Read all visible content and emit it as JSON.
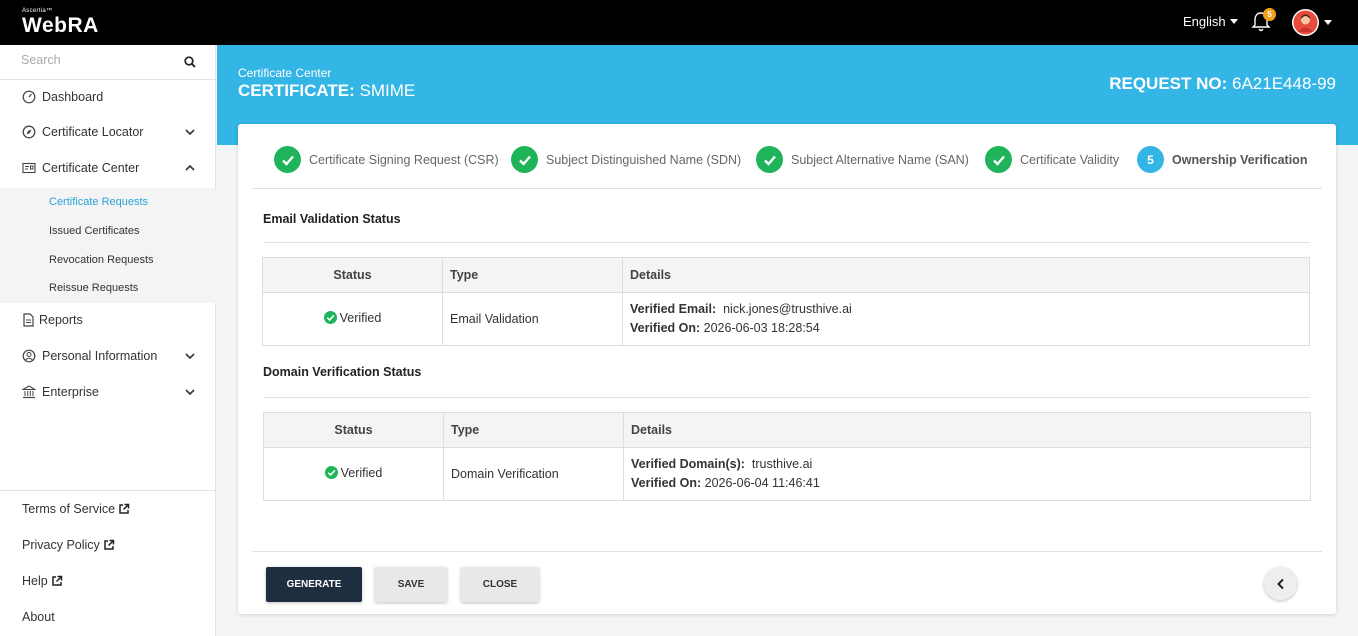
{
  "topbar": {
    "logo_small": "Ascertia™",
    "logo_main": "WebRA",
    "language": "English",
    "notification_count": "5"
  },
  "sidebar": {
    "search_placeholder": "Search",
    "items": [
      {
        "label": "Dashboard"
      },
      {
        "label": "Certificate Locator"
      },
      {
        "label": "Certificate Center"
      },
      {
        "label": "Reports"
      },
      {
        "label": "Personal Information"
      },
      {
        "label": "Enterprise"
      }
    ],
    "sub_items": [
      {
        "label": "Certificate Requests"
      },
      {
        "label": "Issued Certificates"
      },
      {
        "label": "Revocation Requests"
      },
      {
        "label": "Reissue Requests"
      }
    ],
    "footer": [
      {
        "label": "Terms of Service"
      },
      {
        "label": "Privacy Policy"
      },
      {
        "label": "Help"
      },
      {
        "label": "About"
      }
    ]
  },
  "header": {
    "breadcrumb": "Certificate Center",
    "title_prefix": "CERTIFICATE:",
    "title_value": "SMIME",
    "request_prefix": "REQUEST NO:",
    "request_value": "6A21E448-99"
  },
  "steps": [
    {
      "label": "Certificate Signing Request (CSR)",
      "done": true
    },
    {
      "label": "Subject Distinguished Name (SDN)",
      "done": true
    },
    {
      "label": "Subject Alternative Name (SAN)",
      "done": true
    },
    {
      "label": "Certificate Validity",
      "done": true
    },
    {
      "label": "Ownership Verification",
      "done": false,
      "number": "5"
    }
  ],
  "email_section": {
    "title": "Email Validation Status",
    "headers": {
      "status": "Status",
      "type": "Type",
      "details": "Details"
    },
    "row": {
      "status": "Verified",
      "type": "Email Validation",
      "detail1_label": "Verified Email:",
      "detail1_value": "nick.jones@trusthive.ai",
      "detail2_label": "Verified On:",
      "detail2_value": "2026-06-03 18:28:54"
    }
  },
  "domain_section": {
    "title": "Domain Verification Status",
    "headers": {
      "status": "Status",
      "type": "Type",
      "details": "Details"
    },
    "row": {
      "status": "Verified",
      "type": "Domain Verification",
      "detail1_label": "Verified Domain(s):",
      "detail1_value": "trusthive.ai",
      "detail2_label": "Verified On:",
      "detail2_value": "2026-06-04 11:46:41"
    }
  },
  "actions": {
    "generate": "GENERATE",
    "save": "SAVE",
    "close": "CLOSE"
  },
  "colors": {
    "accent": "#33b5e5",
    "success": "#1fb45a",
    "dark_button": "#1e2e40",
    "notification": "#f2a01e"
  }
}
